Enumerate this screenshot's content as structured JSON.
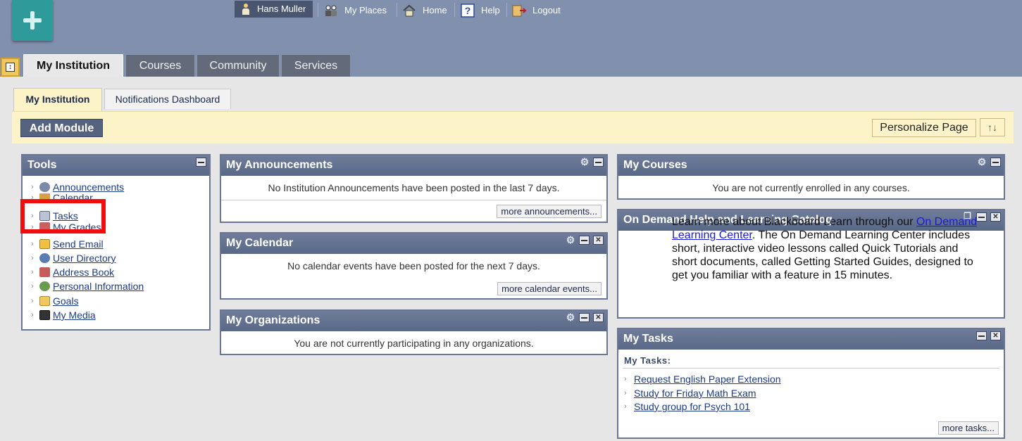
{
  "header": {
    "user_name": "Hans Muller",
    "links": [
      {
        "label": "My Places",
        "icon": "my-places-icon"
      },
      {
        "label": "Home",
        "icon": "home-icon"
      },
      {
        "label": "Help",
        "icon": "help-icon"
      },
      {
        "label": "Logout",
        "icon": "logout-icon"
      }
    ]
  },
  "main_tabs": [
    {
      "label": "My Institution",
      "active": true
    },
    {
      "label": "Courses"
    },
    {
      "label": "Community"
    },
    {
      "label": "Services"
    }
  ],
  "sub_tabs": [
    {
      "label": "My Institution",
      "active": true
    },
    {
      "label": "Notifications Dashboard"
    }
  ],
  "actionbar": {
    "add_module": "Add Module",
    "personalize": "Personalize Page",
    "reorder_icon": "↑↓"
  },
  "tools": {
    "title": "Tools",
    "items": [
      {
        "label": "Announcements",
        "icon": "announcements-icon"
      },
      {
        "label": "Calendar",
        "icon": "calendar-icon"
      },
      {
        "label": "Tasks",
        "icon": "tasks-icon"
      },
      {
        "label": "My Grades",
        "icon": "grades-icon"
      },
      {
        "label": "Send Email",
        "icon": "email-icon"
      },
      {
        "label": "User Directory",
        "icon": "user-directory-icon"
      },
      {
        "label": "Address Book",
        "icon": "address-book-icon"
      },
      {
        "label": "Personal Information",
        "icon": "personal-info-icon"
      },
      {
        "label": "Goals",
        "icon": "goals-folder-icon"
      },
      {
        "label": "My Media",
        "icon": "media-film-icon"
      }
    ]
  },
  "announcements": {
    "title": "My Announcements",
    "message": "No Institution Announcements have been posted in the last 7 days.",
    "more": "more announcements..."
  },
  "calendar": {
    "title": "My Calendar",
    "message": "No calendar events have been posted for the next 7 days.",
    "more": "more calendar events..."
  },
  "organizations": {
    "title": "My Organizations",
    "message": "You are not currently participating in any organizations."
  },
  "courses": {
    "title": "My Courses",
    "message": "You are not currently enrolled in any courses."
  },
  "ondemand": {
    "title": "On Demand Help and Learning Catalog",
    "text_before": "Learn more about Blackboard Learn through our ",
    "link": "On Demand Learning Center",
    "text_after": ". The On Demand Learning Center includes short, interactive video lessons called Quick Tutorials and short documents, called Getting Started Guides, designed to get you familiar with a feature in 15 minutes."
  },
  "tasks": {
    "title": "My Tasks",
    "subheading": "My Tasks:",
    "items": [
      "Request English Paper Extension",
      "Study for Friday Math Exam",
      "Study group for Psych 101"
    ],
    "more": "more tasks..."
  }
}
